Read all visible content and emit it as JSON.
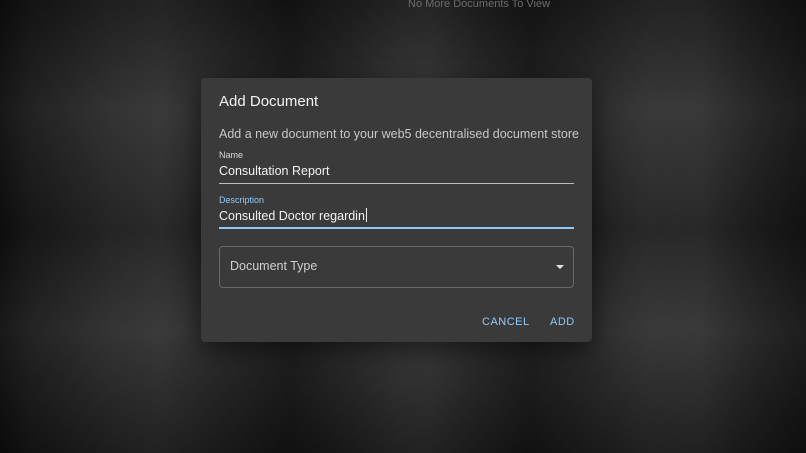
{
  "background": {
    "empty_message": "No More Documents To View"
  },
  "dialog": {
    "title": "Add Document",
    "subtitle": "Add a new document to your web5 decentralised document store",
    "name_field": {
      "label": "Name",
      "value": "Consultation Report"
    },
    "description_field": {
      "label": "Description",
      "value": "Consulted Doctor regardin"
    },
    "document_type_select": {
      "label": "Document Type",
      "icon": "chevron-down-icon"
    },
    "actions": {
      "cancel_label": "CANCEL",
      "add_label": "ADD"
    }
  },
  "colors": {
    "dialog_background": "#3a3a3a",
    "accent": "#90caf9"
  }
}
